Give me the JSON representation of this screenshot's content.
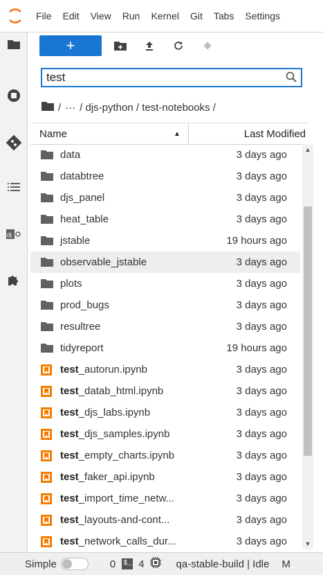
{
  "menubar": {
    "items": [
      "File",
      "Edit",
      "View",
      "Run",
      "Kernel",
      "Git",
      "Tabs",
      "Settings"
    ]
  },
  "toolbar": {
    "new_label": "+"
  },
  "search": {
    "value": "test"
  },
  "breadcrumb": {
    "sep1": "/",
    "ellipsis": "···",
    "path": "/ djs-python / test-notebooks /"
  },
  "header": {
    "name": "Name",
    "modified": "Last Modified"
  },
  "files": [
    {
      "type": "folder",
      "bold": "",
      "rest": "data",
      "modified": "3 days ago"
    },
    {
      "type": "folder",
      "bold": "",
      "rest": "databtree",
      "modified": "3 days ago"
    },
    {
      "type": "folder",
      "bold": "",
      "rest": "djs_panel",
      "modified": "3 days ago"
    },
    {
      "type": "folder",
      "bold": "",
      "rest": "heat_table",
      "modified": "3 days ago"
    },
    {
      "type": "folder",
      "bold": "",
      "rest": "jstable",
      "modified": "19 hours ago"
    },
    {
      "type": "folder",
      "bold": "",
      "rest": "observable_jstable",
      "modified": "3 days ago",
      "selected": true
    },
    {
      "type": "folder",
      "bold": "",
      "rest": "plots",
      "modified": "3 days ago"
    },
    {
      "type": "folder",
      "bold": "",
      "rest": "prod_bugs",
      "modified": "3 days ago"
    },
    {
      "type": "folder",
      "bold": "",
      "rest": "resultree",
      "modified": "3 days ago"
    },
    {
      "type": "folder",
      "bold": "",
      "rest": "tidyreport",
      "modified": "19 hours ago"
    },
    {
      "type": "notebook",
      "bold": "test",
      "rest": "_autorun.ipynb",
      "modified": "3 days ago"
    },
    {
      "type": "notebook",
      "bold": "test",
      "rest": "_datab_html.ipynb",
      "modified": "3 days ago"
    },
    {
      "type": "notebook",
      "bold": "test",
      "rest": "_djs_labs.ipynb",
      "modified": "3 days ago"
    },
    {
      "type": "notebook",
      "bold": "test",
      "rest": "_djs_samples.ipynb",
      "modified": "3 days ago"
    },
    {
      "type": "notebook",
      "bold": "test",
      "rest": "_empty_charts.ipynb",
      "modified": "3 days ago"
    },
    {
      "type": "notebook",
      "bold": "test",
      "rest": "_faker_api.ipynb",
      "modified": "3 days ago"
    },
    {
      "type": "notebook",
      "bold": "test",
      "rest": "_import_time_netw...",
      "modified": "3 days ago"
    },
    {
      "type": "notebook",
      "bold": "test",
      "rest": "_layouts-and-cont...",
      "modified": "3 days ago"
    },
    {
      "type": "notebook",
      "bold": "test",
      "rest": "_network_calls_dur...",
      "modified": "3 days ago"
    }
  ],
  "statusbar": {
    "simple": "Simple",
    "kernels": "0",
    "terminal_icon": "$_",
    "terminals": "4",
    "kernel_status": "qa-stable-build | Idle",
    "mode": "M"
  }
}
